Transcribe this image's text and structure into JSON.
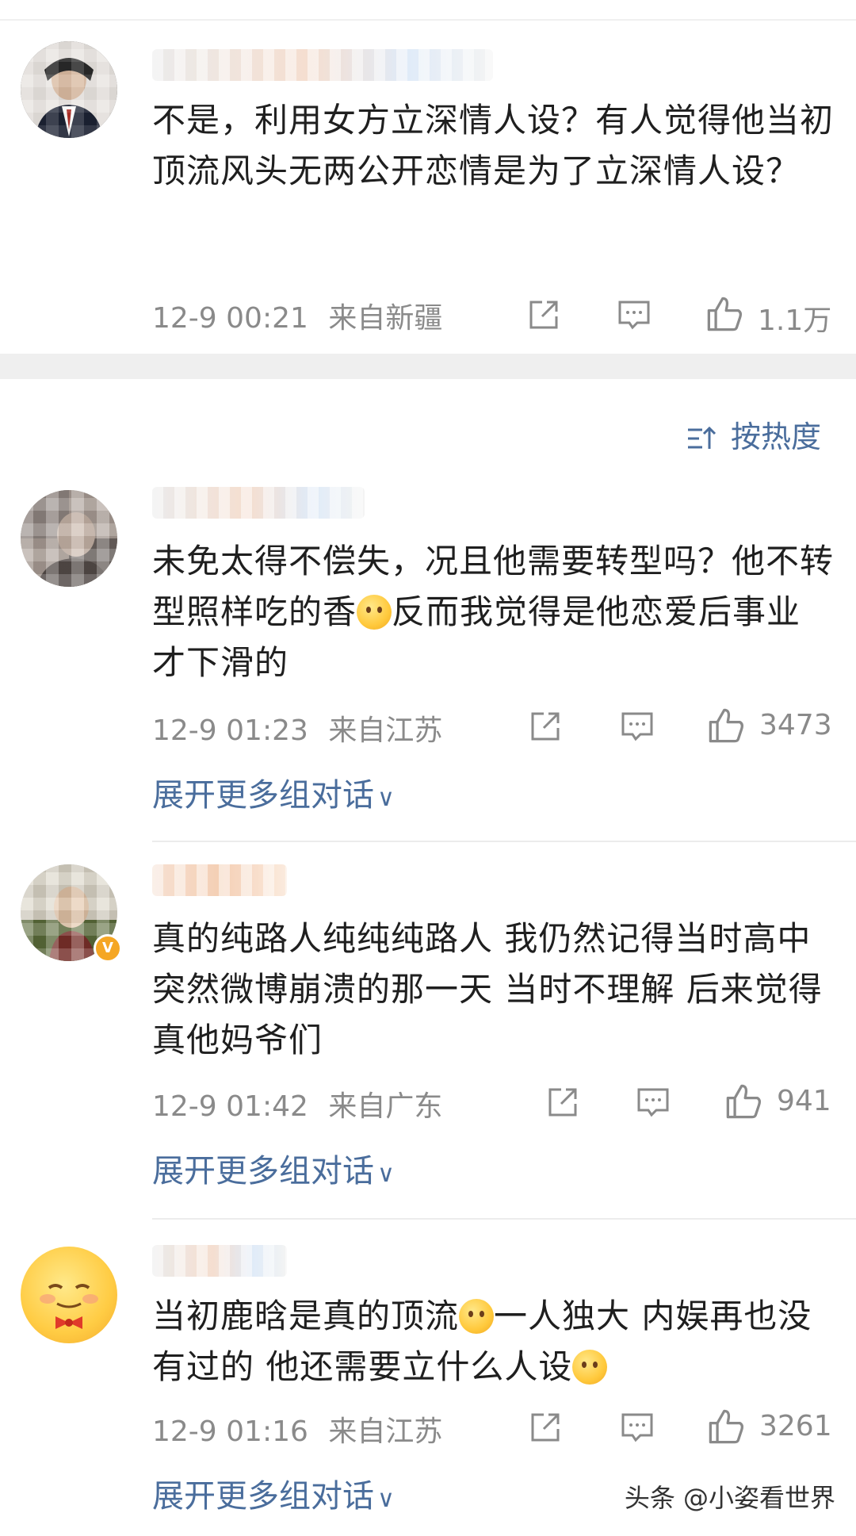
{
  "sort": {
    "label": "按热度"
  },
  "comments": [
    {
      "text": "不是，利用女方立深情人设？有人觉得他当初顶流风头无两公开恋情是为了立深情人设？",
      "time": "12-9 00:21",
      "location": "来自新疆",
      "likes": "1.1万"
    },
    {
      "text_a": "未免太得不偿失，况且他需要转型吗？他不转型照样吃的香",
      "text_b": "反而我觉得是他恋爱后事业才下滑的",
      "time": "12-9 01:23",
      "location": "来自江苏",
      "likes": "3473",
      "expand": "展开更多组对话"
    },
    {
      "text": "真的纯路人纯纯纯路人 我仍然记得当时高中突然微博崩溃的那一天 当时不理解 后来觉得真他妈爷们",
      "time": "12-9 01:42",
      "location": "来自广东",
      "likes": "941",
      "expand": "展开更多组对话"
    },
    {
      "text_a": "当初鹿晗是真的顶流",
      "text_b": "一人独大 内娱再也没有过的 他还需要立什么人设",
      "time": "12-9 01:16",
      "location": "来自江苏",
      "likes": "3261",
      "expand": "展开更多组对话"
    }
  ],
  "watermark": "头条 @小姿看世界",
  "icons": [
    "share-icon",
    "comment-icon",
    "like-icon",
    "sort-icon",
    "chevron-down-icon"
  ]
}
